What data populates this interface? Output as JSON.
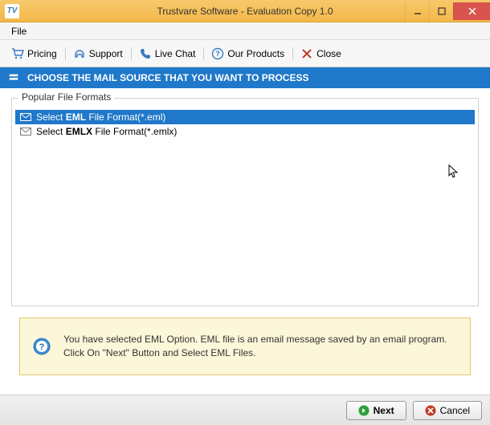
{
  "window": {
    "title": "Trustvare Software - Evaluation Copy 1.0",
    "app_icon_text": "TV"
  },
  "menubar": {
    "file": "File"
  },
  "toolbar": {
    "pricing": "Pricing",
    "support": "Support",
    "live_chat": "Live Chat",
    "our_products": "Our Products",
    "close": "Close"
  },
  "step": {
    "heading": "CHOOSE THE MAIL SOURCE THAT YOU WANT TO PROCESS"
  },
  "group": {
    "legend": "Popular File Formats"
  },
  "formats": [
    {
      "prefix": "Select ",
      "name": "EML",
      "suffix": " File Format(*.eml)",
      "selected": true
    },
    {
      "prefix": "Select ",
      "name": "EMLX",
      "suffix": " File Format(*.emlx)",
      "selected": false
    }
  ],
  "info": {
    "message": "You have selected EML Option. EML file is an email message saved by an email program. Click On \"Next\" Button and Select EML Files."
  },
  "footer": {
    "next": "Next",
    "cancel": "Cancel"
  }
}
